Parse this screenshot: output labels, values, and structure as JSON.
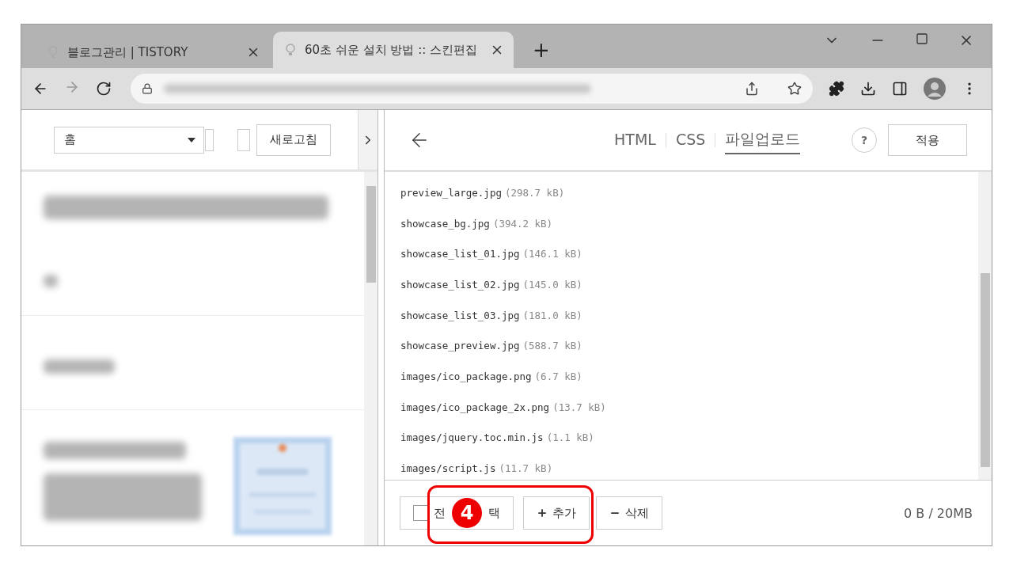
{
  "browser": {
    "tabs": [
      {
        "title": "블로그관리 | TISTORY",
        "selected": false
      },
      {
        "title": "60초 쉬운 설치 방법 :: 스킨편집",
        "selected": true
      }
    ],
    "new_tab": "+",
    "forward_disabled": true
  },
  "preview": {
    "page_select": "홈",
    "refresh_button": "새로고침"
  },
  "editor": {
    "tabs": [
      {
        "label": "HTML",
        "selected": false
      },
      {
        "label": "CSS",
        "selected": false
      },
      {
        "label": "파일업로드",
        "selected": true
      }
    ],
    "help": "?",
    "apply_button": "적용",
    "files": [
      {
        "name": "preview_large.jpg",
        "size": "(298.7 kB)"
      },
      {
        "name": "showcase_bg.jpg",
        "size": "(394.2 kB)"
      },
      {
        "name": "showcase_list_01.jpg",
        "size": "(146.1 kB)"
      },
      {
        "name": "showcase_list_02.jpg",
        "size": "(145.0 kB)"
      },
      {
        "name": "showcase_list_03.jpg",
        "size": "(181.0 kB)"
      },
      {
        "name": "showcase_preview.jpg",
        "size": "(588.7 kB)"
      },
      {
        "name": "images/ico_package.png",
        "size": "(6.7 kB)"
      },
      {
        "name": "images/ico_package_2x.png",
        "size": "(13.7 kB)"
      },
      {
        "name": "images/jquery.toc.min.js",
        "size": "(1.1 kB)"
      },
      {
        "name": "images/script.js",
        "size": "(11.7 kB)"
      }
    ],
    "select_all": {
      "label_start": "전",
      "label_end": "택",
      "checked": false
    },
    "add_button": "추가",
    "delete_button": "삭제",
    "usage": "0 B / 20MB"
  },
  "annotation": {
    "step": "4"
  }
}
